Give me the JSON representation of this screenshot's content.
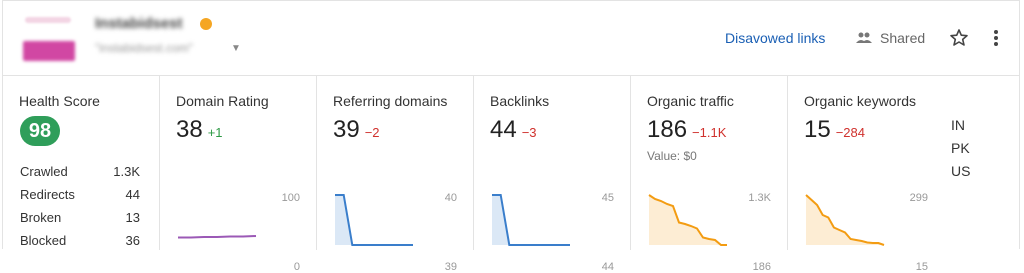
{
  "header": {
    "site_name": "Instabidsest",
    "site_url": "\"instabidsest.com\"",
    "disavowed_label": "Disavowed links",
    "shared_label": "Shared",
    "star_icon": "star-icon",
    "menu_icon": "kebab-menu-icon"
  },
  "health": {
    "title": "Health Score",
    "score": "98",
    "rows": [
      {
        "label": "Crawled",
        "value": "1.3K"
      },
      {
        "label": "Redirects",
        "value": "44"
      },
      {
        "label": "Broken",
        "value": "13"
      },
      {
        "label": "Blocked",
        "value": "36"
      }
    ]
  },
  "metrics": [
    {
      "title": "Domain Rating",
      "value": "38",
      "delta": "+1",
      "delta_type": "pos",
      "sub": "",
      "axis_top": "100",
      "axis_bottom": "0",
      "color": "#9b59b6",
      "fill": false,
      "series": [
        0.15,
        0.15,
        0.16,
        0.16,
        0.17,
        0.17,
        0.18
      ]
    },
    {
      "title": "Referring domains",
      "value": "39",
      "delta": "−2",
      "delta_type": "neg",
      "sub": "",
      "axis_top": "40",
      "axis_bottom": "39",
      "color": "#3a7ecb",
      "fill": true,
      "series": [
        1,
        1,
        0,
        0,
        0,
        0,
        0,
        0,
        0,
        0
      ]
    },
    {
      "title": "Backlinks",
      "value": "44",
      "delta": "−3",
      "delta_type": "neg",
      "sub": "",
      "axis_top": "45",
      "axis_bottom": "44",
      "color": "#3a7ecb",
      "fill": true,
      "series": [
        1,
        1,
        0,
        0,
        0,
        0,
        0,
        0,
        0,
        0
      ]
    },
    {
      "title": "Organic traffic",
      "value": "186",
      "delta": "−1.1K",
      "delta_type": "neg",
      "sub": "Value: $0",
      "axis_top": "1.3K",
      "axis_bottom": "186",
      "color": "#f39c12",
      "fill": true,
      "series": [
        1,
        0.92,
        0.88,
        0.82,
        0.78,
        0.45,
        0.42,
        0.38,
        0.33,
        0.15,
        0.12,
        0.1,
        0,
        0
      ]
    },
    {
      "title": "Organic keywords",
      "value": "15",
      "delta": "−284",
      "delta_type": "neg",
      "sub": "",
      "axis_top": "299",
      "axis_bottom": "15",
      "color": "#f39c12",
      "fill": true,
      "series": [
        1,
        0.9,
        0.8,
        0.6,
        0.55,
        0.35,
        0.3,
        0.25,
        0.12,
        0.1,
        0.08,
        0.05,
        0.04,
        0.04,
        0
      ]
    }
  ],
  "countries": [
    "IN",
    "PK",
    "US"
  ]
}
